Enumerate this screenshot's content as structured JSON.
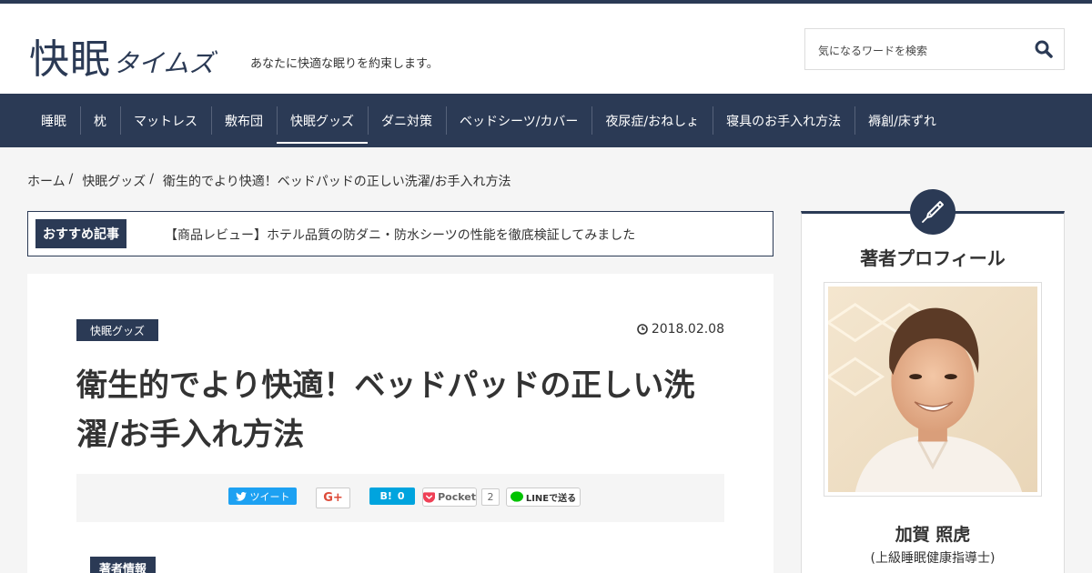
{
  "site": {
    "logo_main": "快眠",
    "logo_sub": "タイムズ",
    "tagline": "あなたに快適な眠りを約束します。"
  },
  "search": {
    "placeholder": "気になるワードを検索"
  },
  "nav": {
    "items": [
      "睡眠",
      "枕",
      "マットレス",
      "敷布団",
      "快眠グッズ",
      "ダニ対策",
      "ベッドシーツ/カバー",
      "夜尿症/おねしょ",
      "寝具のお手入れ方法",
      "褥創/床ずれ"
    ],
    "active": "快眠グッズ"
  },
  "breadcrumb": {
    "items": [
      "ホーム",
      "快眠グッズ",
      "衛生的でより快適！ベッドパッドの正しい洗濯/お手入れ方法"
    ],
    "separator": "/"
  },
  "recommend": {
    "label": "おすすめ記事",
    "title": "【商品レビュー】ホテル品質の防ダニ・防水シーツの性能を徹底検証してみました"
  },
  "article": {
    "category": "快眠グッズ",
    "date": "2018.02.08",
    "title": "衛生的でより快適！ベッドパッドの正しい洗濯/お手入れ方法",
    "author_tag": "著者情報"
  },
  "share": {
    "tweet": "ツイート",
    "gplus": "G+",
    "hatena_label": "B!",
    "hatena_count": "0",
    "pocket": "Pocket",
    "pocket_count": "2",
    "line": "LINEで送る"
  },
  "sidebar": {
    "heading": "著者プロフィール",
    "name": "加賀 照虎",
    "title": "(上級睡眠健康指導士)"
  },
  "colors": {
    "navy": "#2b3a55",
    "twitter": "#1da1f2",
    "hatena": "#00a4de",
    "pocket": "#ef4056",
    "line": "#00c300"
  }
}
